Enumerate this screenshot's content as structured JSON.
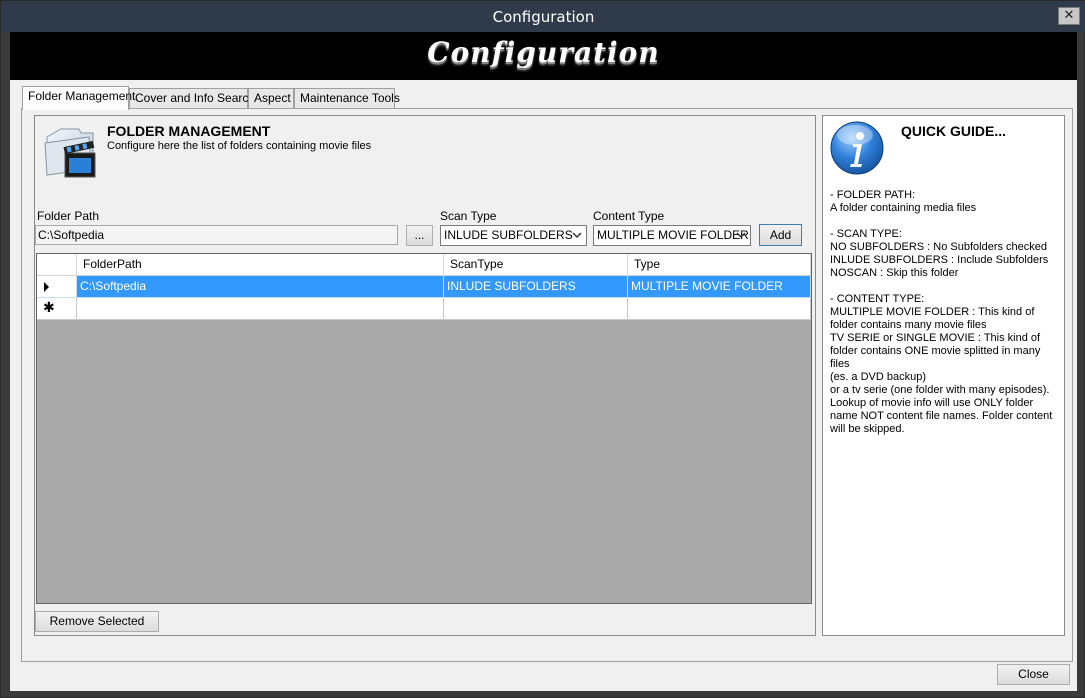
{
  "window": {
    "title": "Configuration",
    "close_glyph": "✕"
  },
  "banner": {
    "title": "Configuration"
  },
  "tabs": [
    {
      "label": "Folder Management"
    },
    {
      "label": "Cover and Info Search"
    },
    {
      "label": "Aspect"
    },
    {
      "label": "Maintenance Tools"
    }
  ],
  "folder_management": {
    "heading": "FOLDER MANAGEMENT",
    "description": "Configure here the list of folders containing movie files",
    "folder_path_label": "Folder Path",
    "folder_path_value": "C:\\Softpedia",
    "browse_label": "...",
    "scan_type_label": "Scan Type",
    "scan_type_value": "INLUDE SUBFOLDERS",
    "content_type_label": "Content Type",
    "content_type_value": "MULTIPLE MOVIE FOLDER",
    "add_label": "Add",
    "remove_label": "Remove Selected"
  },
  "grid": {
    "columns": [
      "FolderPath",
      "ScanType",
      "Type"
    ],
    "rows": [
      {
        "folder_path": "C:\\Softpedia",
        "scan_type": "INLUDE SUBFOLDERS",
        "type": "MULTIPLE MOVIE FOLDER"
      }
    ],
    "new_row_glyph": "✱"
  },
  "quick_guide": {
    "title": "QUICK GUIDE...",
    "text": "- FOLDER PATH:\nA folder containing media files\n\n- SCAN TYPE:\nNO SUBFOLDERS : No Subfolders checked\nINLUDE SUBFOLDERS : Include Subfolders\nNOSCAN : Skip this folder\n\n - CONTENT TYPE:\n MULTIPLE MOVIE FOLDER : This kind of\nfolder contains many movie files\nTV SERIE or SINGLE MOVIE : This kind of\nfolder contains ONE movie splitted in many files\n(es. a DVD backup)\nor a tv serie (one folder with many episodes).\nLookup of movie info will use ONLY folder\nname NOT content file names. Folder content\nwill be skipped."
  },
  "footer": {
    "close_label": "Close"
  },
  "colors": {
    "selection": "#3399ff",
    "grid_background": "#a9a9a9",
    "titlebar": "#2f3b4a"
  },
  "icons": [
    "folder-movie-icon",
    "info-icon",
    "close-icon",
    "dropdown-arrow-icon",
    "current-row-icon",
    "new-row-icon"
  ]
}
